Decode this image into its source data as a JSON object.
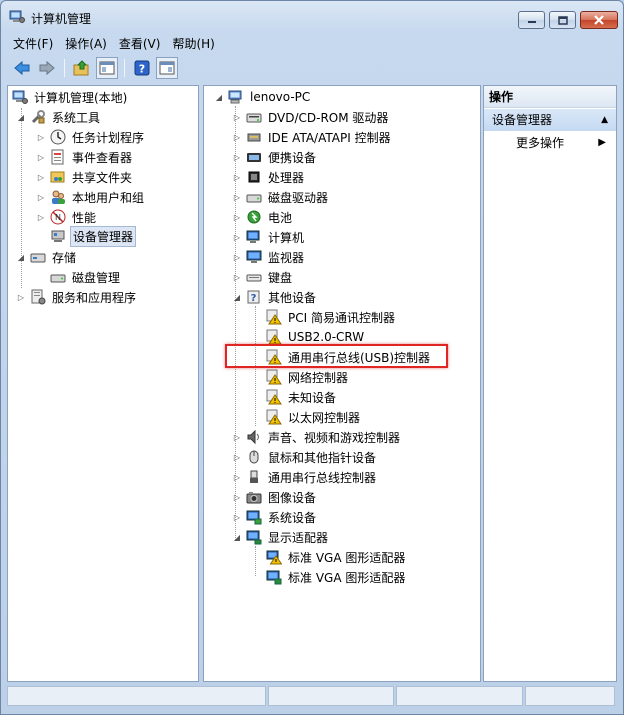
{
  "window": {
    "title": "计算机管理",
    "minimize_glyph": "─",
    "maximize_glyph": "□",
    "close_glyph": "✕"
  },
  "menu": [
    "文件(F)",
    "操作(A)",
    "查看(V)",
    "帮助(H)"
  ],
  "toolbar": {
    "buttons": [
      "back-arrow-icon",
      "forward-arrow-icon",
      "up-folder-icon",
      "show-hide-tree-icon",
      "help-icon",
      "action-pane-icon"
    ]
  },
  "left_tree": {
    "root": "计算机管理(本地)",
    "system_tools": "系统工具",
    "system_tools_children": [
      "任务计划程序",
      "事件查看器",
      "共享文件夹",
      "本地用户和组",
      "性能",
      "设备管理器"
    ],
    "storage": "存储",
    "storage_children": [
      "磁盘管理"
    ],
    "services": "服务和应用程序"
  },
  "device_tree": {
    "root": "lenovo-PC",
    "categories_top": [
      "DVD/CD-ROM 驱动器",
      "IDE ATA/ATAPI 控制器",
      "便携设备",
      "处理器",
      "磁盘驱动器",
      "电池",
      "计算机",
      "监视器",
      "键盘"
    ],
    "other_devices": "其他设备",
    "other_devices_children": [
      "PCI 简易通讯控制器",
      "USB2.0-CRW",
      "通用串行总线(USB)控制器",
      "网络控制器",
      "未知设备",
      "以太网控制器"
    ],
    "categories_bottom": [
      "声音、视频和游戏控制器",
      "鼠标和其他指针设备",
      "通用串行总线控制器",
      "图像设备",
      "系统设备"
    ],
    "display_adapters": "显示适配器",
    "display_adapters_children": [
      "标准 VGA 图形适配器",
      "标准 VGA 图形适配器"
    ]
  },
  "actions": {
    "header": "操作",
    "section": "设备管理器",
    "more": "更多操作",
    "collapse_glyph": "▲",
    "more_glyph": "▶"
  },
  "colors": {
    "highlight_box": "#e02525",
    "warning": "#f2c200"
  }
}
